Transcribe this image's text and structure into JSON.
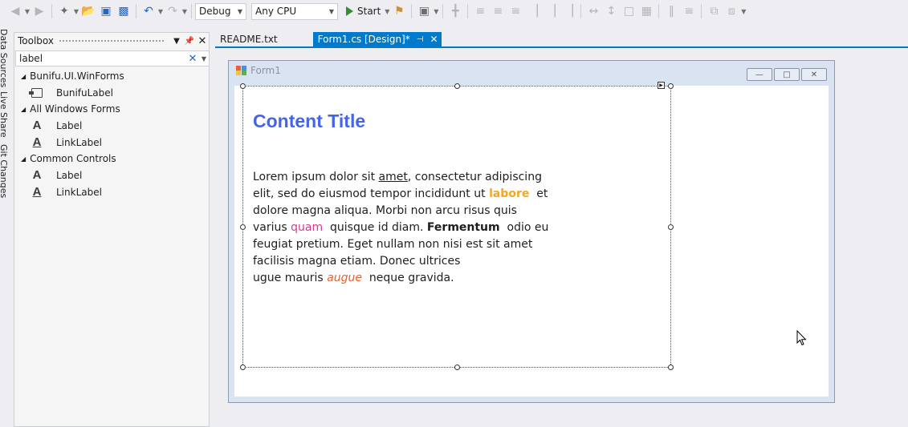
{
  "toolbar": {
    "config": "Debug",
    "platform": "Any CPU",
    "start_label": "Start"
  },
  "sidetabs": [
    "Data Sources",
    "Live Share",
    "Git Changes"
  ],
  "toolbox": {
    "title": "Toolbox",
    "search_value": "label",
    "groups": [
      {
        "name": "Bunifu.UI.WinForms",
        "items": [
          {
            "label": "BunifuLabel",
            "icon": "bunifu-label-icon"
          }
        ]
      },
      {
        "name": "All Windows Forms",
        "items": [
          {
            "label": "Label",
            "icon": "label-icon"
          },
          {
            "label": "LinkLabel",
            "icon": "linklabel-icon"
          }
        ]
      },
      {
        "name": "Common Controls",
        "items": [
          {
            "label": "Label",
            "icon": "label-icon"
          },
          {
            "label": "LinkLabel",
            "icon": "linklabel-icon"
          }
        ]
      }
    ]
  },
  "doc_tabs": {
    "readme": "README.txt",
    "form_design": "Form1.cs [Design]*"
  },
  "form": {
    "title": "Form1",
    "content_title": "Content Title",
    "body": {
      "l1a": "Lorem ipsum dolor sit ",
      "l1b": "amet",
      "l1c": ", consectetur adipiscing",
      "l2a": "elit, sed do eiusmod tempor incididunt ut ",
      "l2b": "labore",
      "l2c": "et",
      "l3": "dolore magna aliqua. Morbi non arcu risus quis",
      "l4a": "varius ",
      "l4b": "quam",
      "l4c": "quisque id diam. ",
      "l4d": "Fermentum",
      "l4e": "odio eu",
      "l5": "feugiat pretium. Eget nullam non nisi est sit amet",
      "l6": "facilisis magna etiam. Donec ultrices",
      "l7a": "ugue mauris ",
      "l7b": "augue",
      "l7c": "neque gravida."
    }
  },
  "colors": {
    "accent": "#007acc",
    "title": "#4664e6",
    "labore": "#f5a623",
    "quam": "#e0368f",
    "augue": "#e8602c"
  }
}
